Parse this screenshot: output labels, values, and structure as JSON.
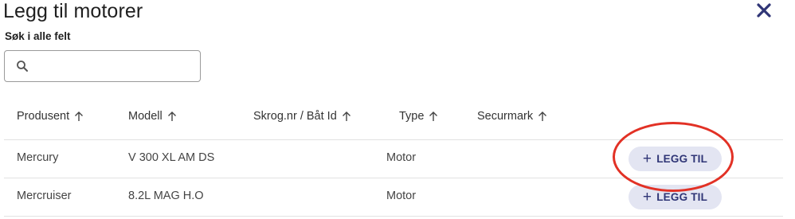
{
  "dialog": {
    "title": "Legg til motorer",
    "close_icon": "close-icon"
  },
  "search": {
    "label": "Søk i alle felt",
    "value": "",
    "placeholder": "",
    "icon": "search-icon"
  },
  "table": {
    "columns": [
      {
        "label": "Produsent",
        "sort_icon": "arrow-up-icon"
      },
      {
        "label": "Modell",
        "sort_icon": "arrow-up-icon"
      },
      {
        "label": "Skrog.nr / Båt Id",
        "sort_icon": "arrow-up-icon"
      },
      {
        "label": "Type",
        "sort_icon": "arrow-up-icon"
      },
      {
        "label": "Securmark",
        "sort_icon": "arrow-up-icon"
      }
    ],
    "rows": [
      {
        "produsent": "Mercury",
        "modell": "V 300 XL AM DS",
        "skrog": "",
        "type": "Motor",
        "securmark": "",
        "action": "LEGG TIL"
      },
      {
        "produsent": "Mercruiser",
        "modell": "8.2L MAG H.O",
        "skrog": "",
        "type": "Motor",
        "securmark": "",
        "action": "LEGG TIL"
      }
    ]
  },
  "colors": {
    "accent_text": "#2f3576",
    "button_bg": "#e3e5f2",
    "highlight_circle": "#e23125",
    "close_icon": "#2f3576"
  }
}
